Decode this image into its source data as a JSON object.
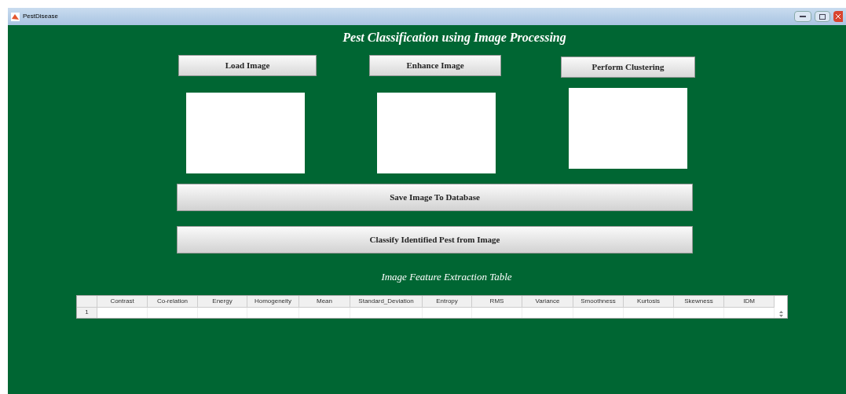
{
  "window": {
    "title": "PestDisease"
  },
  "heading": "Pest Classification using Image Processing",
  "top_buttons": [
    "Load Image",
    "Enhance Image",
    "Perform Clustering"
  ],
  "wide_buttons": [
    "Save Image To Database",
    "Classify Identified Pest from Image"
  ],
  "table": {
    "title": "Image Feature Extraction Table",
    "columns": [
      "Contrast",
      "Co-relation",
      "Energy",
      "Homogeneity",
      "Mean",
      "Standard_Deviation",
      "Entropy",
      "RMS",
      "Variance",
      "Smoothness",
      "Kurtosis",
      "Skewness",
      "IDM"
    ],
    "rows": [
      {
        "header": "1"
      }
    ]
  }
}
